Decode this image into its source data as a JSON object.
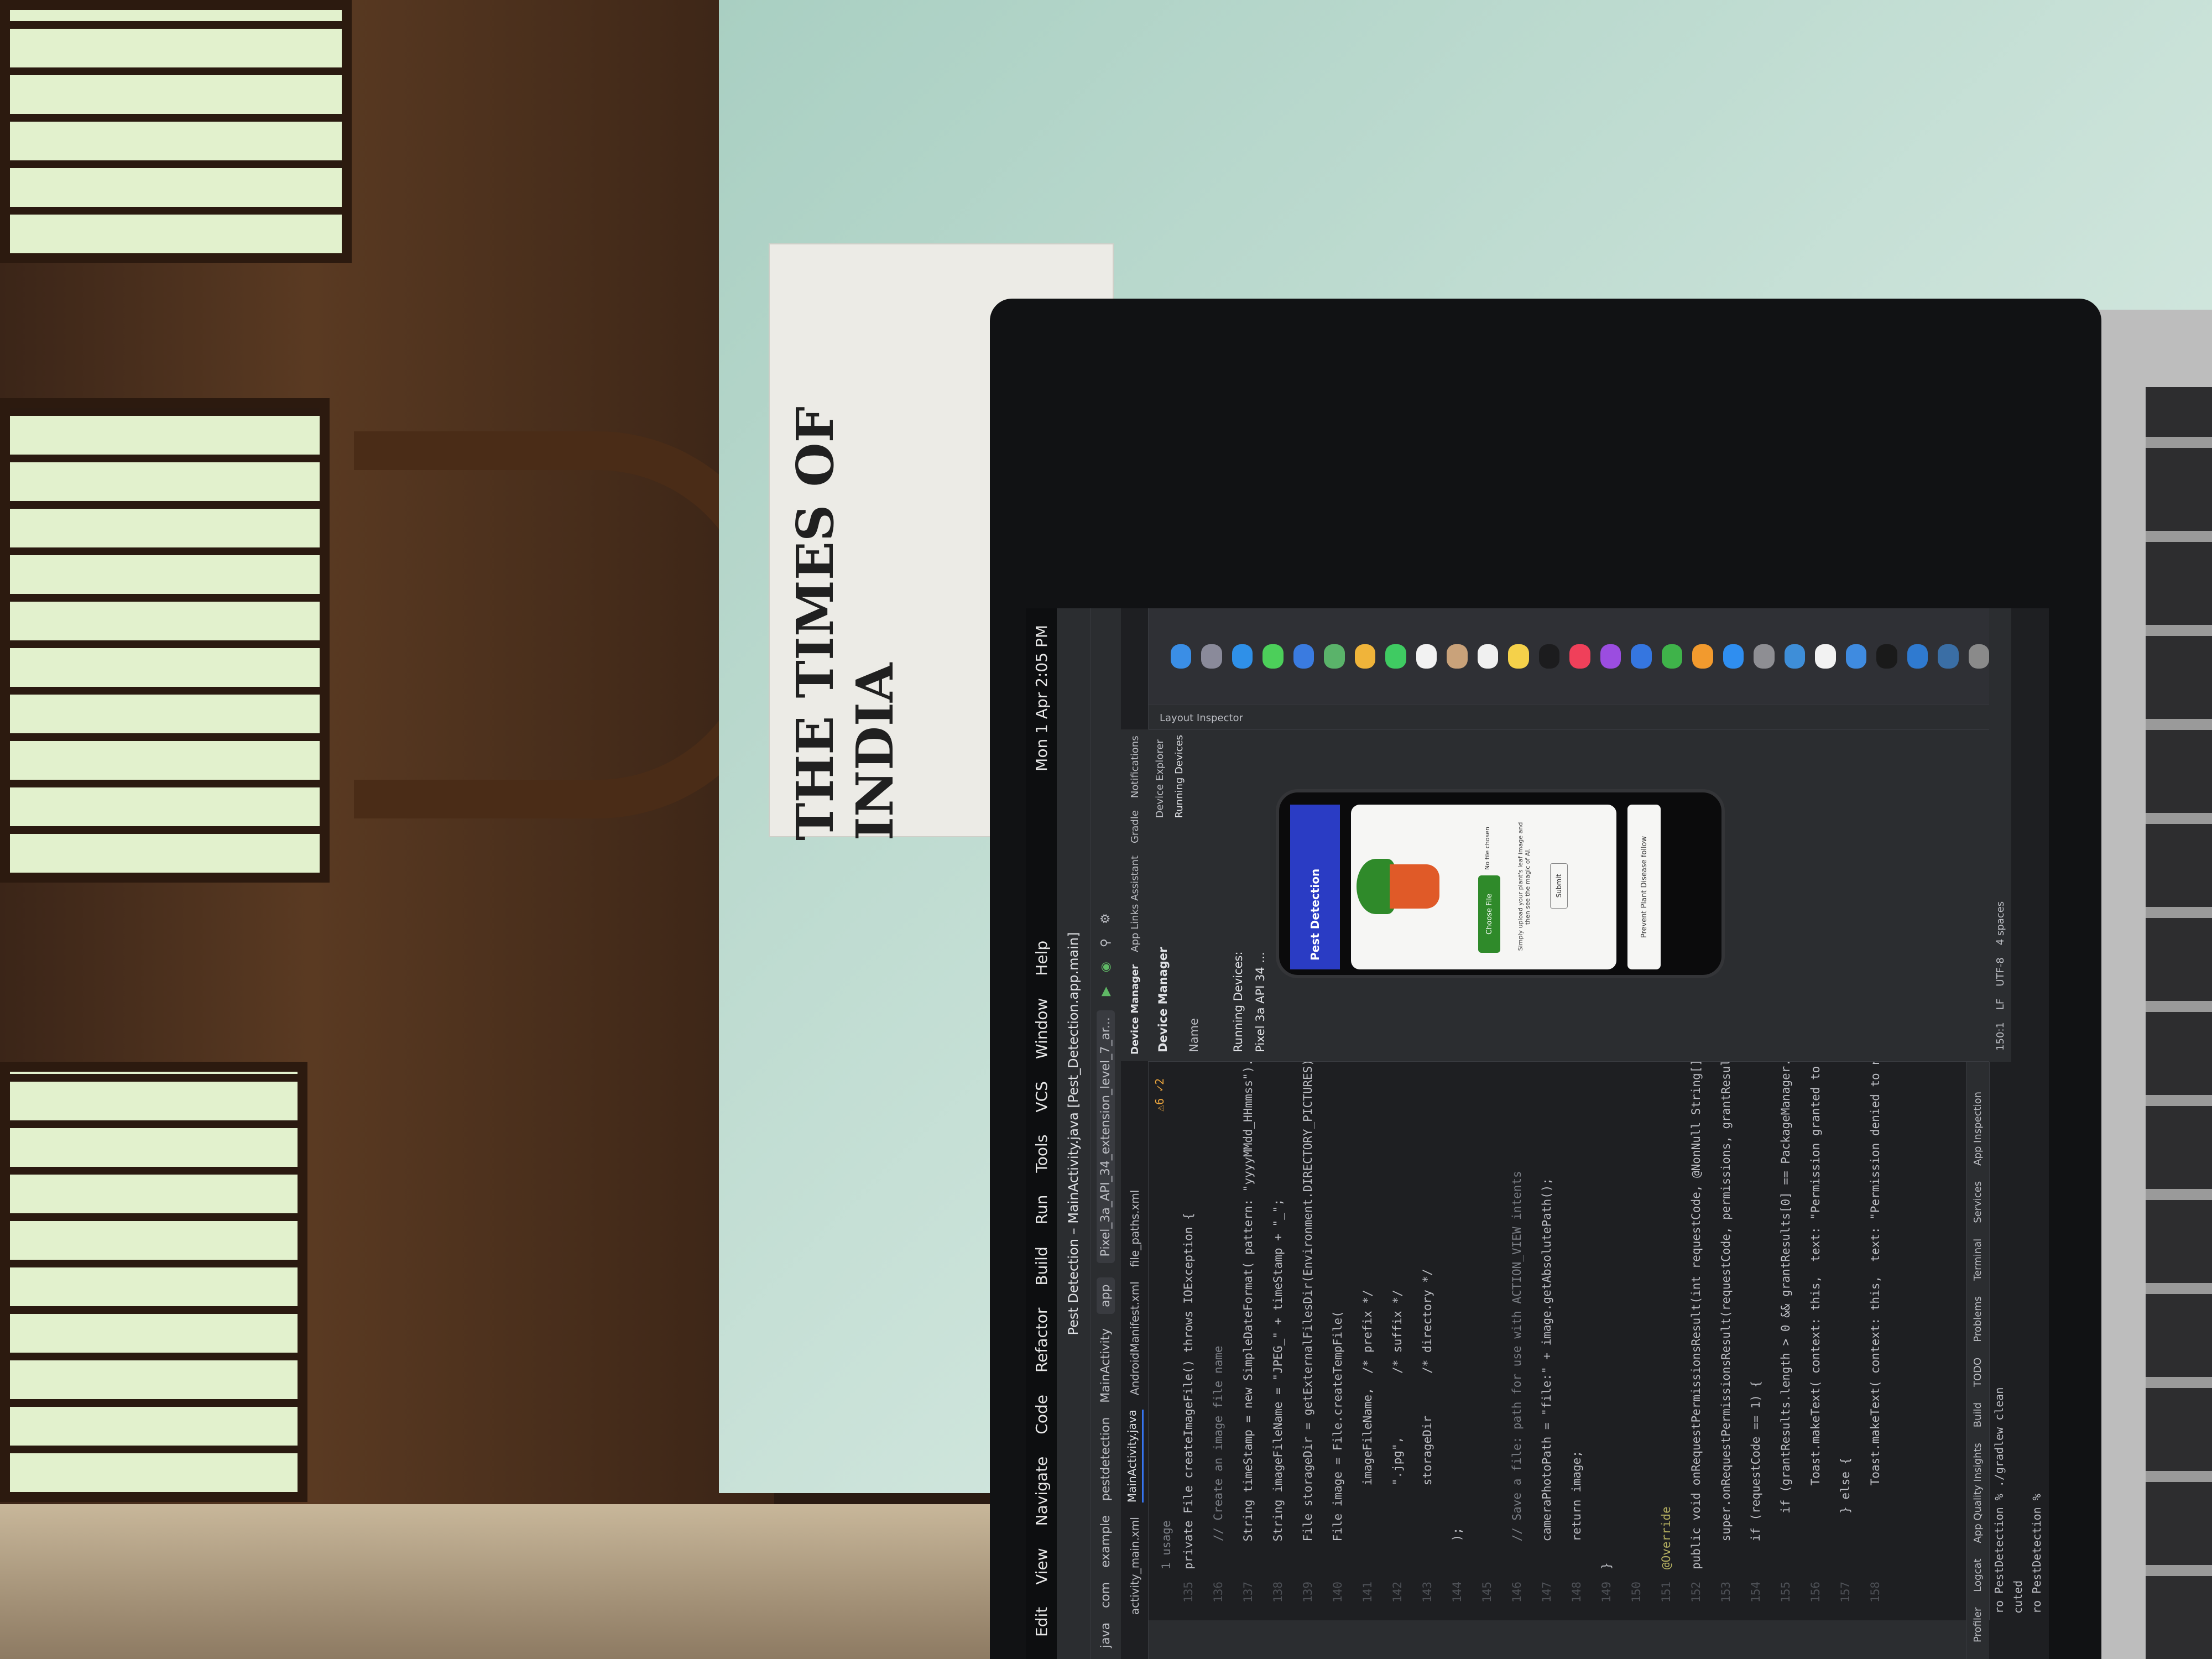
{
  "scene": {
    "newspaper_masthead": "THE TIMES OF INDIA"
  },
  "mac_menubar": {
    "items": [
      "Edit",
      "View",
      "Navigate",
      "Code",
      "Refactor",
      "Build",
      "Run",
      "Tools",
      "VCS",
      "Window",
      "Help"
    ],
    "clock": "Mon 1 Apr 2:05 PM"
  },
  "window": {
    "title": "Pest Detection – MainActivity.java [Pest_Detection.app.main]"
  },
  "navbar": {
    "breadcrumb": [
      "java",
      "com",
      "example",
      "pestdetection",
      "MainActivity"
    ],
    "run_config": "app",
    "device": "Pixel_3a_API_34_extension_level_7_ar..."
  },
  "tabs": [
    {
      "label": "activity_main.xml",
      "active": false
    },
    {
      "label": "MainActivity.java",
      "active": true
    },
    {
      "label": "AndroidManifest.xml",
      "active": false
    },
    {
      "label": "file_paths.xml",
      "active": false
    }
  ],
  "editor": {
    "inspections": "⚠6 ✓2",
    "usage_hint": "1 usage",
    "lines": [
      {
        "n": "135",
        "text": "private File createImageFile() throws IOException {"
      },
      {
        "n": "136",
        "text": "    // Create an image file name"
      },
      {
        "n": "137",
        "text": "    String timeStamp = new SimpleDateFormat( pattern: \"yyyyMMdd_HHmmss\").format(new Date());"
      },
      {
        "n": "138",
        "text": "    String imageFileName = \"JPEG_\" + timeStamp + \"_\";"
      },
      {
        "n": "139",
        "text": "    File storageDir = getExternalFilesDir(Environment.DIRECTORY_PICTURES);"
      },
      {
        "n": "140",
        "text": "    File image = File.createTempFile("
      },
      {
        "n": "141",
        "text": "            imageFileName,  /* prefix */"
      },
      {
        "n": "142",
        "text": "            \".jpg\",         /* suffix */"
      },
      {
        "n": "143",
        "text": "            storageDir      /* directory */"
      },
      {
        "n": "144",
        "text": "    );"
      },
      {
        "n": "145",
        "text": ""
      },
      {
        "n": "146",
        "text": "    // Save a file: path for use with ACTION_VIEW intents"
      },
      {
        "n": "147",
        "text": "    cameraPhotoPath = \"file:\" + image.getAbsolutePath();"
      },
      {
        "n": "148",
        "text": "    return image;"
      },
      {
        "n": "149",
        "text": "}"
      },
      {
        "n": "150",
        "text": ""
      },
      {
        "n": "151",
        "text": "@Override"
      },
      {
        "n": "152",
        "text": "public void onRequestPermissionsResult(int requestCode, @NonNull String[] permissions, @"
      },
      {
        "n": "153",
        "text": "    super.onRequestPermissionsResult(requestCode, permissions, grantResults);"
      },
      {
        "n": "154",
        "text": "    if (requestCode == 1) {"
      },
      {
        "n": "155",
        "text": "        if (grantResults.length > 0 && grantResults[0] == PackageManager.PERMISSION_GRAN"
      },
      {
        "n": "156",
        "text": "            Toast.makeText( context: this,  text: \"Permission granted to read your External s"
      },
      {
        "n": "157",
        "text": "        } else {"
      },
      {
        "n": "158",
        "text": "            Toast.makeText( context: this,  text: \"Permission denied to read your External st"
      }
    ]
  },
  "terminal": {
    "lines": [
      "ro PestDetection % ./gradlew clean",
      "cuted",
      "ro PestDetection % "
    ]
  },
  "bottom_tools": [
    "Profiler",
    "Logcat",
    "App Quality Insights",
    "Build",
    "TODO",
    "Problems",
    "Terminal",
    "Services",
    "App Inspection"
  ],
  "device_manager": {
    "tabs": [
      "Device Manager",
      "App Links Assistant",
      "Gradle",
      "Notifications"
    ],
    "title": "Device Manager",
    "name_col": "Name",
    "running_devices": "Running Devices:",
    "device_name": "Pixel 3a API 34 ...",
    "right_tabs": [
      "Device Explorer",
      "Running Devices"
    ]
  },
  "phone_app": {
    "app_title": "Pest Detection",
    "choose_file": "Choose File",
    "no_file": "No file chosen",
    "help_text": "Simply upload your plant's leaf image and then see the magic of AI.",
    "submit": "Submit",
    "banner": "Prevent Plant Disease follow"
  },
  "status_bar": {
    "position": "150:1",
    "line_sep": "LF",
    "encoding": "UTF-8",
    "indent": "4 spaces",
    "layout_inspector": "Layout Inspector"
  },
  "dock_icons": [
    "finder-icon",
    "launchpad-icon",
    "safari-icon",
    "messages-icon",
    "mail-icon",
    "maps-icon",
    "photos-icon",
    "facetime-icon",
    "calendar-icon",
    "contacts-icon",
    "reminders-icon",
    "notes-icon",
    "tv-icon",
    "music-icon",
    "podcasts-icon",
    "keynote-icon",
    "numbers-icon",
    "pages-icon",
    "app-store-icon",
    "system-settings-icon",
    "preview-icon",
    "chrome-icon",
    "xcode-icon",
    "terminal-icon",
    "vscode-icon",
    "python-icon",
    "trash-icon"
  ],
  "colors": {
    "ide_bg": "#1e1f22",
    "panel_bg": "#2b2d30",
    "accent": "#3574f0",
    "app_bar": "#2a3cc4",
    "keyword": "#cf8e6d",
    "string": "#6aab73",
    "warning": "#e8a33d"
  }
}
